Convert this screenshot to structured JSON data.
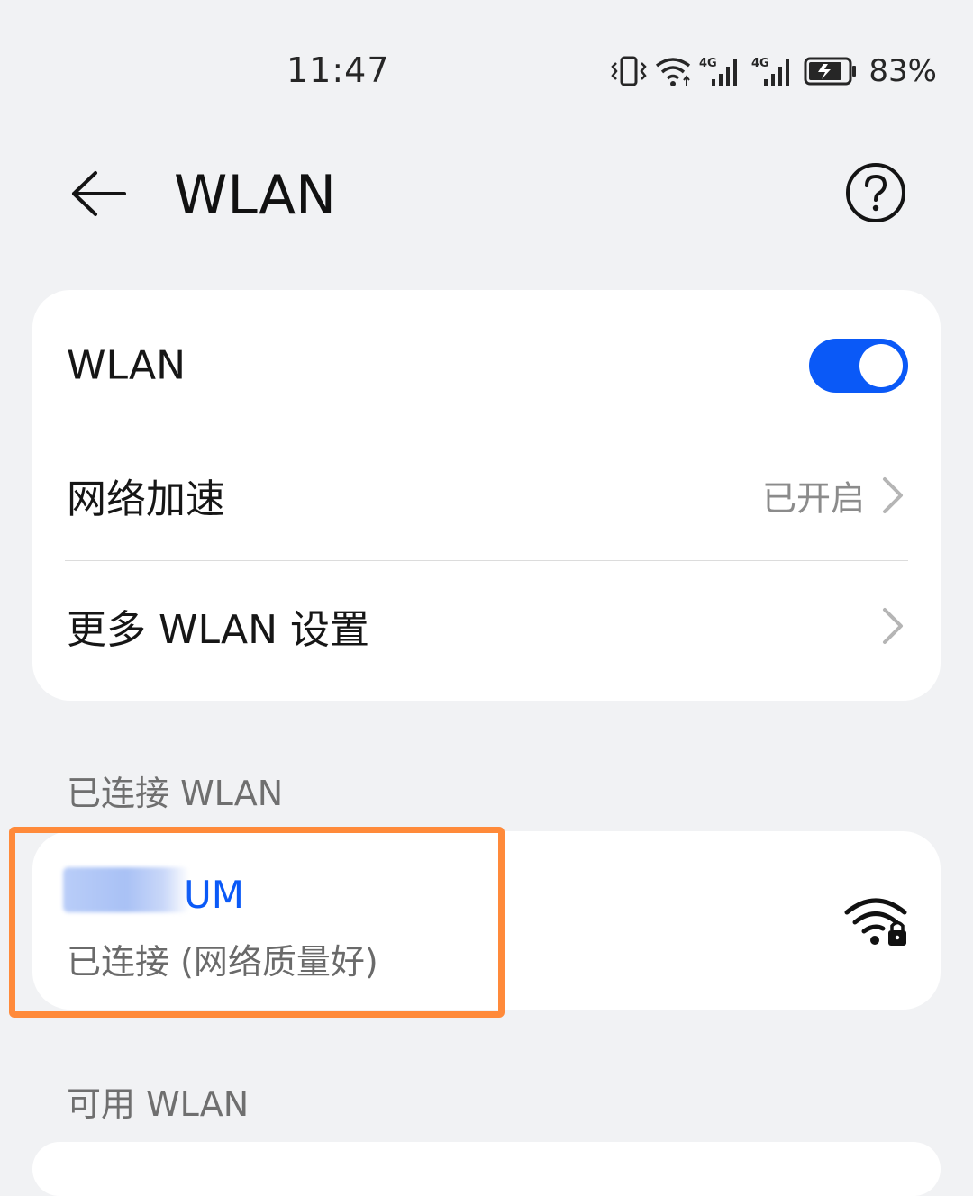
{
  "status_bar": {
    "time": "11:47",
    "battery_percent": "83%",
    "signal_label_1": "4G",
    "signal_label_2": "4G",
    "icons": [
      "vibrate-icon",
      "wifi-status-icon",
      "signal-4g-icon",
      "signal-4g-icon",
      "battery-charging-icon"
    ]
  },
  "header": {
    "title": "WLAN",
    "back_icon": "back-arrow-icon",
    "help_icon": "help-icon"
  },
  "settings": {
    "wlan_label": "WLAN",
    "wlan_enabled": true,
    "accel_label": "网络加速",
    "accel_value": "已开启",
    "more_label": "更多 WLAN 设置"
  },
  "connected": {
    "section_title": "已连接 WLAN",
    "network_name": "UM",
    "network_status": "已连接 (网络质量好)",
    "signal_icon": "wifi-lock-icon"
  },
  "available": {
    "section_title": "可用 WLAN"
  },
  "colors": {
    "accent": "#0a59f7",
    "background": "#f1f2f4",
    "highlight": "#ff8a3a"
  }
}
